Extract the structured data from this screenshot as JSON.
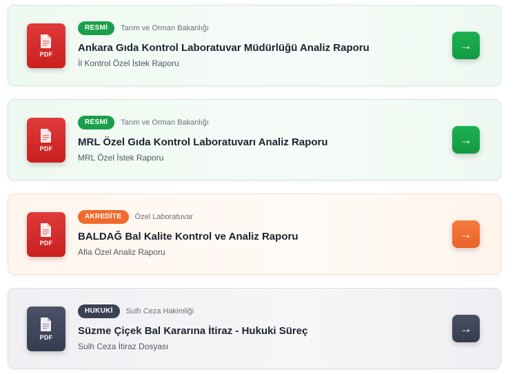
{
  "reports": [
    {
      "badge": "RESMİ",
      "source": "Tarım ve Orman Bakanlığı",
      "title": "Ankara Gıda Kontrol Laboratuvar Müdürlüğü Analiz Raporu",
      "subtitle": "İl Kontrol Özel İstek Raporu",
      "file_label": "PDF",
      "arrow": "→"
    },
    {
      "badge": "RESMİ",
      "source": "Tarım ve Orman Bakanlığı",
      "title": "MRL Özel Gıda Kontrol Laboratuvarı Analiz Raporu",
      "subtitle": "MRL Özel İstek Raporu",
      "file_label": "PDF",
      "arrow": "→"
    },
    {
      "badge": "AKREDİTE",
      "source": "Özel Laboratuvar",
      "title": "BALDAĞ Bal Kalite Kontrol ve Analiz Raporu",
      "subtitle": "Afia Özel Analiz Raporu",
      "file_label": "PDF",
      "arrow": "→"
    },
    {
      "badge": "HUKUKİ",
      "source": "Sulh Ceza Hakimliği",
      "title": "Süzme Çiçek Bal Kararına İtiraz - Hukuki Süreç",
      "subtitle": "Sulh Ceza İtiraz Dosyası",
      "file_label": "PDF",
      "arrow": "→"
    }
  ],
  "colors": {
    "official_green": "#1aa04a",
    "accredited_orange": "#f06a2e",
    "legal_dark": "#3b4154",
    "pdf_red": "#d62b2b",
    "pdf_dark": "#40465b"
  }
}
